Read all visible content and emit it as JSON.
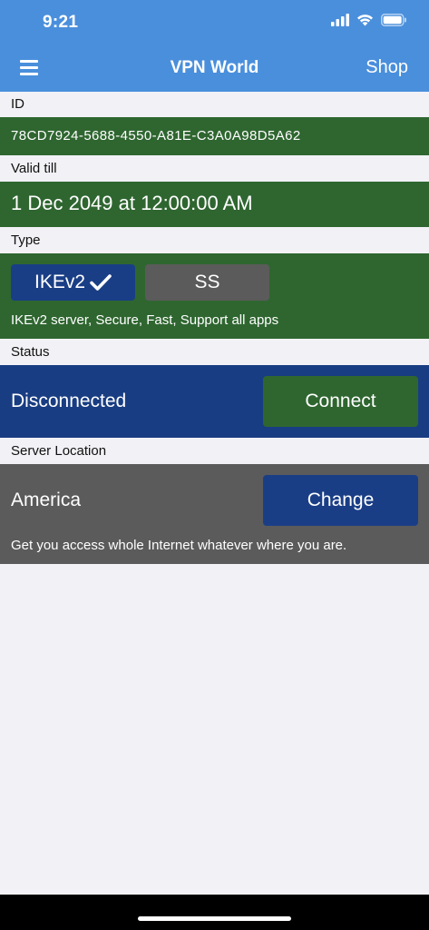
{
  "status_bar": {
    "time": "9:21"
  },
  "nav": {
    "title": "VPN World",
    "shop_label": "Shop"
  },
  "id_section": {
    "label": "ID",
    "value": "78CD7924-5688-4550-A81E-C3A0A98D5A62"
  },
  "valid_section": {
    "label": "Valid till",
    "value": "1 Dec 2049 at 12:00:00 AM"
  },
  "type_section": {
    "label": "Type",
    "options": [
      {
        "label": "IKEv2",
        "selected": true
      },
      {
        "label": "SS",
        "selected": false
      }
    ],
    "description": "IKEv2 server, Secure, Fast, Support all apps"
  },
  "status_section": {
    "label": "Status",
    "value": "Disconnected",
    "button_label": "Connect"
  },
  "location_section": {
    "label": "Server Location",
    "value": "America",
    "button_label": "Change",
    "description": "Get you access whole Internet whatever where you are."
  },
  "colors": {
    "nav_blue": "#4a8fdc",
    "panel_green": "#2f6630",
    "panel_blue": "#193d82",
    "panel_gray": "#5b5b5b",
    "background": "#f1f1f6"
  }
}
